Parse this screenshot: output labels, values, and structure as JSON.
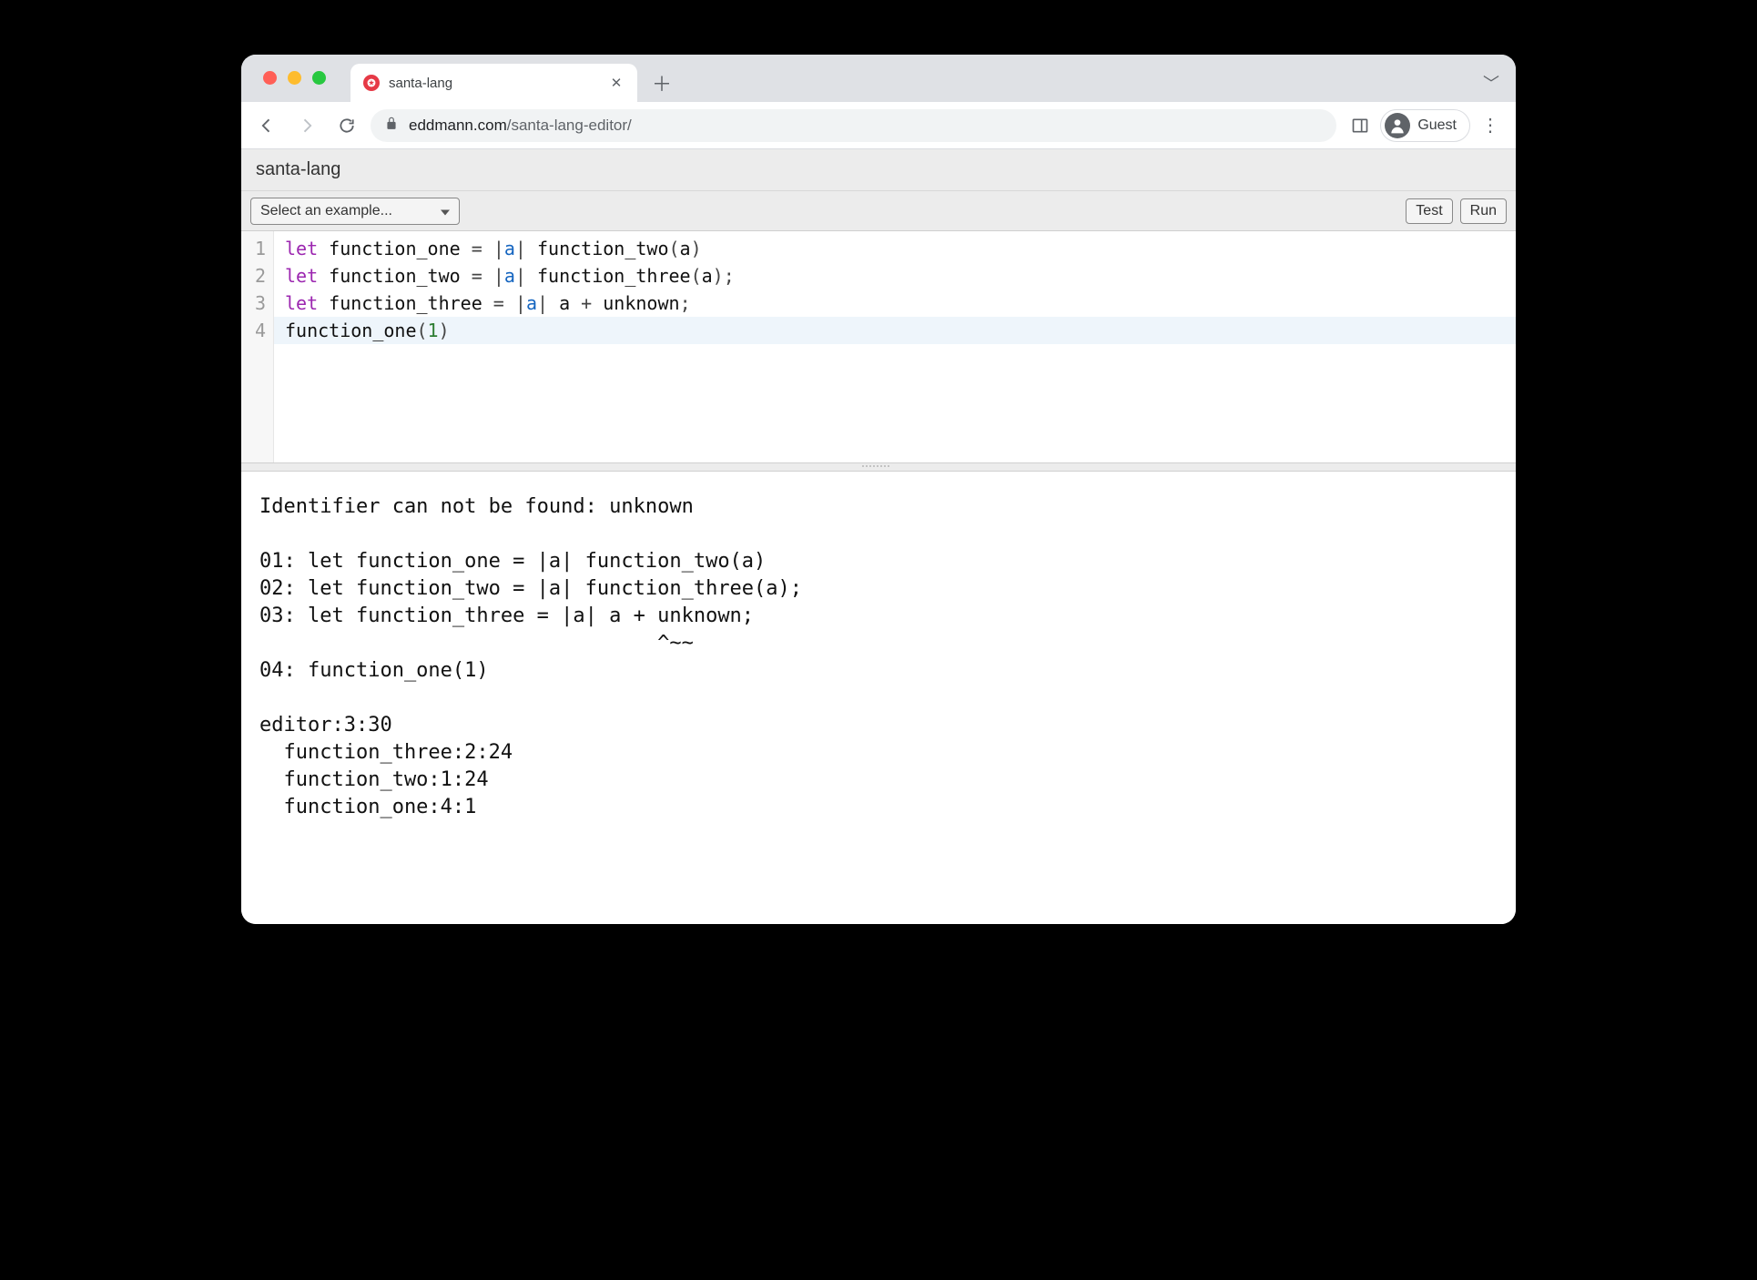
{
  "browser": {
    "tab": {
      "title": "santa-lang",
      "favicon_glyph": "✪"
    },
    "url": {
      "host": "eddmann.com",
      "path": "/santa-lang-editor/"
    },
    "guest_label": "Guest"
  },
  "app": {
    "title": "santa-lang",
    "example_select_label": "Select an example...",
    "test_label": "Test",
    "run_label": "Run"
  },
  "editor": {
    "active_line": 4,
    "lines": [
      {
        "num": "1",
        "tokens": [
          {
            "t": "let",
            "c": "let"
          },
          {
            "t": "sp",
            "c": " "
          },
          {
            "t": "fn",
            "c": "function_one"
          },
          {
            "t": "sp",
            "c": " "
          },
          {
            "t": "punc",
            "c": "="
          },
          {
            "t": "sp",
            "c": " "
          },
          {
            "t": "punc",
            "c": "|"
          },
          {
            "t": "param",
            "c": "a"
          },
          {
            "t": "punc",
            "c": "|"
          },
          {
            "t": "sp",
            "c": " "
          },
          {
            "t": "fn",
            "c": "function_two"
          },
          {
            "t": "punc",
            "c": "("
          },
          {
            "t": "fn",
            "c": "a"
          },
          {
            "t": "punc",
            "c": ")"
          }
        ]
      },
      {
        "num": "2",
        "tokens": [
          {
            "t": "let",
            "c": "let"
          },
          {
            "t": "sp",
            "c": " "
          },
          {
            "t": "fn",
            "c": "function_two"
          },
          {
            "t": "sp",
            "c": " "
          },
          {
            "t": "punc",
            "c": "="
          },
          {
            "t": "sp",
            "c": " "
          },
          {
            "t": "punc",
            "c": "|"
          },
          {
            "t": "param",
            "c": "a"
          },
          {
            "t": "punc",
            "c": "|"
          },
          {
            "t": "sp",
            "c": " "
          },
          {
            "t": "fn",
            "c": "function_three"
          },
          {
            "t": "punc",
            "c": "("
          },
          {
            "t": "fn",
            "c": "a"
          },
          {
            "t": "punc",
            "c": ")"
          },
          {
            "t": "punc",
            "c": ";"
          }
        ]
      },
      {
        "num": "3",
        "tokens": [
          {
            "t": "let",
            "c": "let"
          },
          {
            "t": "sp",
            "c": " "
          },
          {
            "t": "fn",
            "c": "function_three"
          },
          {
            "t": "sp",
            "c": " "
          },
          {
            "t": "punc",
            "c": "="
          },
          {
            "t": "sp",
            "c": " "
          },
          {
            "t": "punc",
            "c": "|"
          },
          {
            "t": "param",
            "c": "a"
          },
          {
            "t": "punc",
            "c": "|"
          },
          {
            "t": "sp",
            "c": " "
          },
          {
            "t": "fn",
            "c": "a"
          },
          {
            "t": "sp",
            "c": " "
          },
          {
            "t": "punc",
            "c": "+"
          },
          {
            "t": "sp",
            "c": " "
          },
          {
            "t": "fn",
            "c": "unknown"
          },
          {
            "t": "punc",
            "c": ";"
          }
        ]
      },
      {
        "num": "4",
        "tokens": [
          {
            "t": "fn",
            "c": "function_one"
          },
          {
            "t": "punc",
            "c": "("
          },
          {
            "t": "num",
            "c": "1"
          },
          {
            "t": "punc",
            "c": ")"
          }
        ]
      }
    ]
  },
  "output": "Identifier can not be found: unknown\n\n01: let function_one = |a| function_two(a)\n02: let function_two = |a| function_three(a);\n03: let function_three = |a| a + unknown;\n                                 ^~~\n04: function_one(1)\n\neditor:3:30\n  function_three:2:24\n  function_two:1:24\n  function_one:4:1"
}
